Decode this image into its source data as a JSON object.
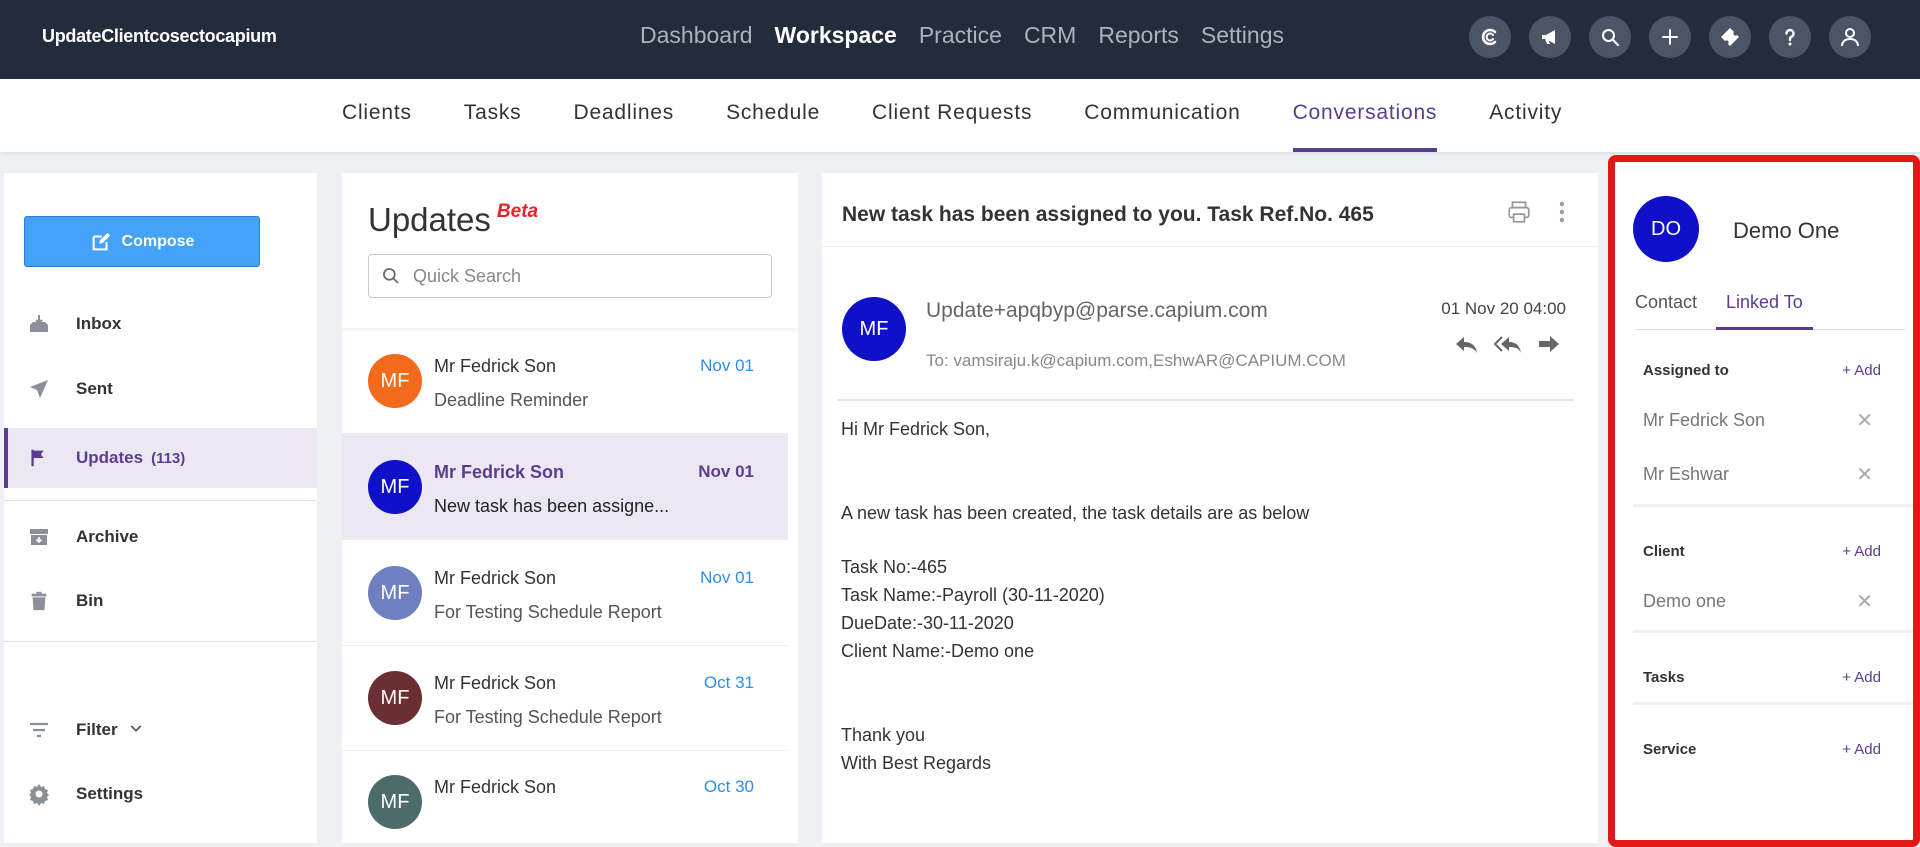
{
  "app": {
    "brand": "UpdateClientcosectocapium",
    "nav": [
      "Dashboard",
      "Workspace",
      "Practice",
      "CRM",
      "Reports",
      "Settings"
    ],
    "nav_active": "Workspace",
    "icons": [
      "capium-logo-icon",
      "megaphone-icon",
      "search-icon",
      "plus-icon",
      "ticket-icon",
      "help-icon",
      "user-icon"
    ]
  },
  "subnav": {
    "tabs": [
      "Clients",
      "Tasks",
      "Deadlines",
      "Schedule",
      "Client Requests",
      "Communication",
      "Conversations",
      "Activity"
    ],
    "active": "Conversations"
  },
  "sidebar": {
    "compose_label": "Compose",
    "items": [
      {
        "label": "Inbox",
        "icon": "inbox-icon"
      },
      {
        "label": "Sent",
        "icon": "send-icon"
      },
      {
        "label": "Updates",
        "count": "(113)",
        "icon": "flag-icon"
      },
      {
        "label": "Archive",
        "icon": "archive-icon"
      },
      {
        "label": "Bin",
        "icon": "trash-icon"
      },
      {
        "label": "Filter",
        "icon": "filter-icon"
      },
      {
        "label": "Settings",
        "icon": "gear-icon"
      }
    ]
  },
  "list": {
    "title": "Updates",
    "badge": "Beta",
    "search_placeholder": "Quick Search",
    "items": [
      {
        "initials": "MF",
        "name": "Mr Fedrick Son",
        "subject": "Deadline Reminder",
        "date": "Nov 01",
        "color": "#f26b1d"
      },
      {
        "initials": "MF",
        "name": "Mr Fedrick Son",
        "subject": "New task has been assigne...",
        "date": "Nov 01",
        "color": "#1010c8"
      },
      {
        "initials": "MF",
        "name": "Mr Fedrick Son",
        "subject": "For Testing Schedule Report",
        "date": "Nov 01",
        "color": "#6f7fc0"
      },
      {
        "initials": "MF",
        "name": "Mr Fedrick Son",
        "subject": "For Testing Schedule Report",
        "date": "Oct 31",
        "color": "#6b2f33"
      },
      {
        "initials": "MF",
        "name": "Mr Fedrick Son",
        "subject": "",
        "date": "Oct 30",
        "color": "#4d6b6b"
      }
    ]
  },
  "message": {
    "subject": "New task has been assigned to you. Task Ref.No. 465",
    "sender_initials": "MF",
    "sender": "Update+apqbyp@parse.capium.com",
    "to": "To: vamsiraju.k@capium.com,EshwAR@CAPIUM.COM",
    "date": "01 Nov 20 04:00",
    "body": {
      "greeting": "Hi Mr Fedrick Son,",
      "intro": "A new task has been created, the task details are as below",
      "task_no": "Task No:-465",
      "task_name": "Task Name:-Payroll (30-11-2020)",
      "due": "DueDate:-30-11-2020",
      "client": "Client Name:-Demo one",
      "thanks": "Thank you",
      "regards": "With Best Regards"
    }
  },
  "contact": {
    "initials": "DO",
    "name": "Demo One",
    "tabs": [
      "Contact",
      "Linked To"
    ],
    "active_tab": "Linked To",
    "add_label": "Add",
    "assigned_title": "Assigned to",
    "assigned": [
      "Mr Fedrick Son",
      "Mr Eshwar"
    ],
    "client_title": "Client",
    "client": "Demo one",
    "tasks_title": "Tasks",
    "service_title": "Service"
  }
}
